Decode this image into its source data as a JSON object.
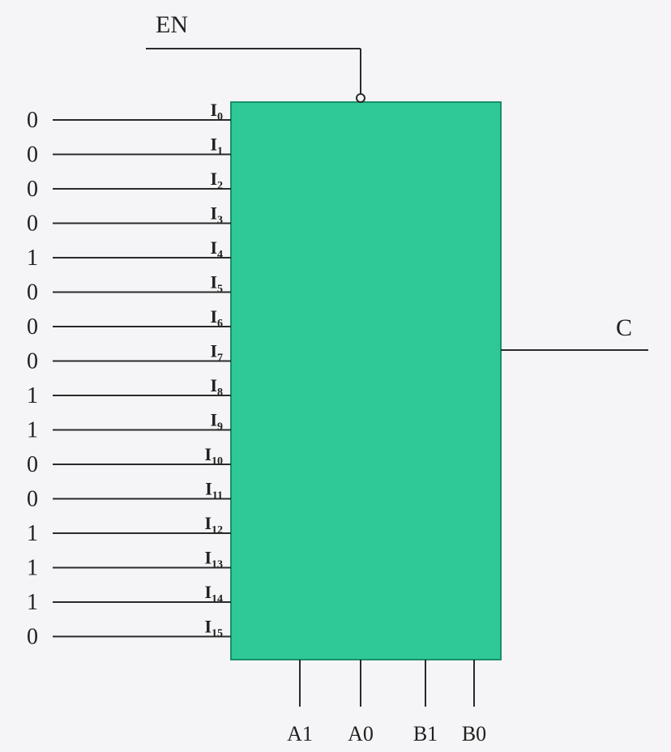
{
  "enable": {
    "label": "EN"
  },
  "inputs": [
    {
      "value": "0",
      "pin": "I",
      "sub": "0"
    },
    {
      "value": "0",
      "pin": "I",
      "sub": "1"
    },
    {
      "value": "0",
      "pin": "I",
      "sub": "2"
    },
    {
      "value": "0",
      "pin": "I",
      "sub": "3"
    },
    {
      "value": "1",
      "pin": "I",
      "sub": "4"
    },
    {
      "value": "0",
      "pin": "I",
      "sub": "5"
    },
    {
      "value": "0",
      "pin": "I",
      "sub": "6"
    },
    {
      "value": "0",
      "pin": "I",
      "sub": "7"
    },
    {
      "value": "1",
      "pin": "I",
      "sub": "8"
    },
    {
      "value": "1",
      "pin": "I",
      "sub": "9"
    },
    {
      "value": "0",
      "pin": "I",
      "sub": "10"
    },
    {
      "value": "0",
      "pin": "I",
      "sub": "11"
    },
    {
      "value": "1",
      "pin": "I",
      "sub": "12"
    },
    {
      "value": "1",
      "pin": "I",
      "sub": "13"
    },
    {
      "value": "1",
      "pin": "I",
      "sub": "14"
    },
    {
      "value": "0",
      "pin": "I",
      "sub": "15"
    }
  ],
  "output": {
    "label": "C"
  },
  "selects": [
    {
      "label": "A1"
    },
    {
      "label": "A0"
    },
    {
      "label": "B1"
    },
    {
      "label": "B0"
    }
  ],
  "colors": {
    "box_fill": "#2ec996",
    "box_stroke": "#1a8f67",
    "line": "#2a2a2a",
    "text": "#202020"
  }
}
